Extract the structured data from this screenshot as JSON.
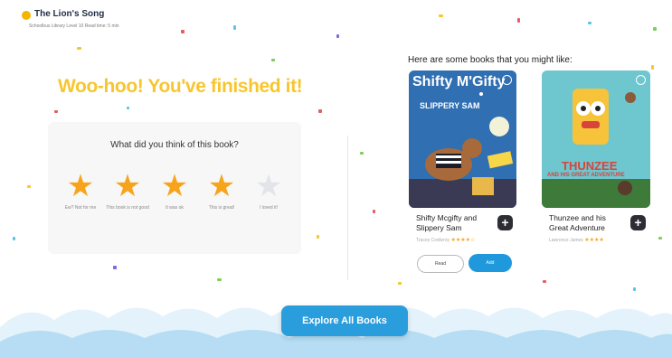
{
  "header": {
    "book_title": "The Lion's Song",
    "book_meta": "Schoolbus Library    Level 10    Read time: 5 min"
  },
  "main": {
    "finished_message": "Woo-hoo! You've finished it!",
    "rating_question": "What did you think of this book?",
    "rating_options": [
      {
        "label": "Ew? Not for me",
        "filled": true
      },
      {
        "label": "This book is not good",
        "filled": true
      },
      {
        "label": "It was ok",
        "filled": true
      },
      {
        "label": "This is great!",
        "filled": true
      },
      {
        "label": "I loved it!",
        "filled": false
      }
    ]
  },
  "recommendations": {
    "heading": "Here are some books that you might like:",
    "books": [
      {
        "cover_title": "Shifty M'Gifty",
        "cover_subtitle": "SLIPPERY SAM",
        "title": "Shifty Mcgifty and Slippery Sam",
        "author": "Tracey Corderoy",
        "stars": "★★★★☆",
        "read_label": "Read",
        "add_label": "Add",
        "add_icon": "+"
      },
      {
        "cover_title": "THUNZEE",
        "cover_subtitle": "AND HIS GREAT ADVENTURE",
        "title": "Thunzee and his Great Adventure",
        "author": "Lawrence James",
        "stars": "★★★★",
        "add_icon": "+"
      }
    ]
  },
  "footer": {
    "explore_label": "Explore All Books"
  },
  "colors": {
    "accent_yellow": "#f7c62f",
    "star": "#f7a41d",
    "primary_blue": "#2a9ddc",
    "wave_light": "#e4f3fb",
    "wave_mid": "#b6ddf3"
  }
}
